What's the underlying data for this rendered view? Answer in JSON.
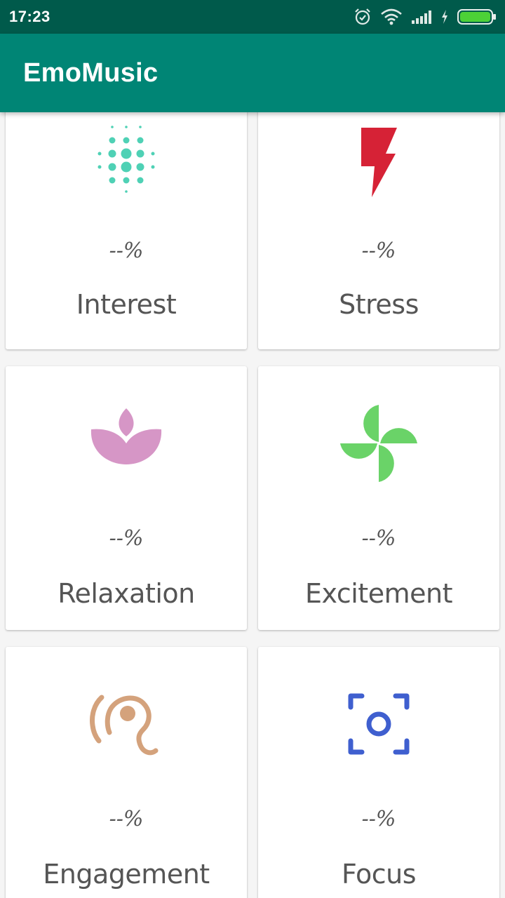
{
  "status_bar": {
    "time": "17:23",
    "icons": [
      "alarm-icon",
      "wifi-icon",
      "signal-icon",
      "charging-icon",
      "battery-icon"
    ],
    "battery_color": "#4cd137"
  },
  "app_bar": {
    "title": "EmoMusic",
    "color": "#008575"
  },
  "metrics": [
    {
      "id": "interest",
      "label": "Interest",
      "value": "--%",
      "icon": "dots-icon",
      "color": "#4fd1b5"
    },
    {
      "id": "stress",
      "label": "Stress",
      "value": "--%",
      "icon": "lightning-icon",
      "color": "#d62236"
    },
    {
      "id": "relaxation",
      "label": "Relaxation",
      "value": "--%",
      "icon": "lotus-icon",
      "color": "#d696c6"
    },
    {
      "id": "excitement",
      "label": "Excitement",
      "value": "--%",
      "icon": "pinwheel-icon",
      "color": "#6ad368"
    },
    {
      "id": "engagement",
      "label": "Engagement",
      "value": "--%",
      "icon": "ear-icon",
      "color": "#d4a27c"
    },
    {
      "id": "focus",
      "label": "Focus",
      "value": "--%",
      "icon": "focus-icon",
      "color": "#3f5fcf"
    }
  ]
}
